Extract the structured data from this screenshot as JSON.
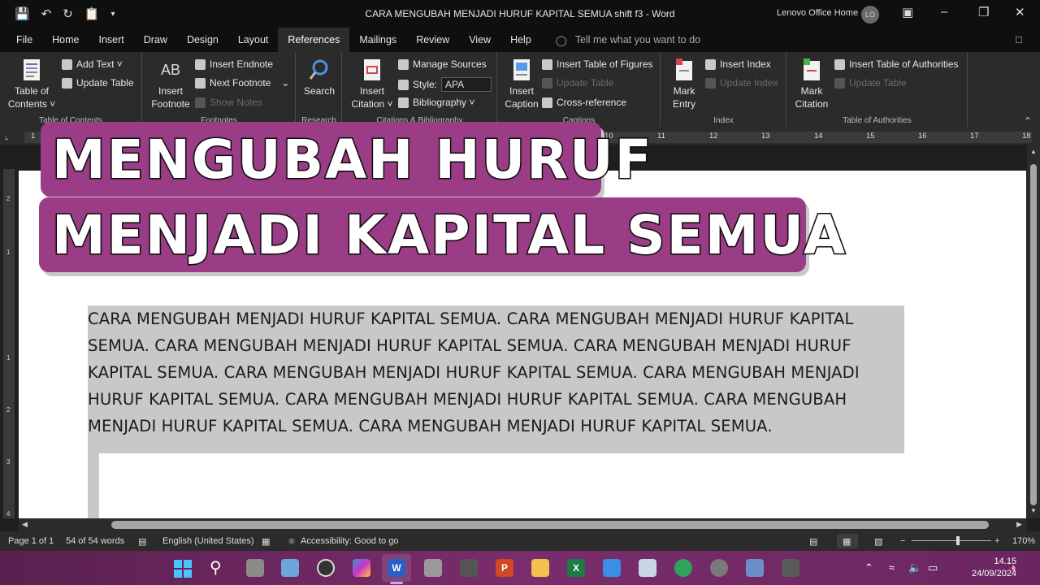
{
  "window": {
    "title": "CARA MENGUBAH MENJADI HURUF KAPITAL SEMUA shift f3  -  Word",
    "account": "Lenovo Office Home",
    "avatar_initials": "LO"
  },
  "tabs": [
    "File",
    "Home",
    "Insert",
    "Draw",
    "Design",
    "Layout",
    "References",
    "Mailings",
    "Review",
    "View",
    "Help"
  ],
  "tell_me": "Tell me what you want to do",
  "ribbon": {
    "toc": {
      "table_of_contents": "Table of Contents ˅",
      "add_text": "Add Text ˅",
      "update_table": "Update Table",
      "label": "Table of Contents"
    },
    "footnotes": {
      "insert_footnote": "Insert Footnote",
      "ab_glyph": "AB",
      "insert_endnote": "Insert Endnote",
      "next_footnote": "Next Footnote",
      "show_notes": "Show Notes",
      "label": "Footnotes"
    },
    "research": {
      "search": "Search",
      "label": "Research"
    },
    "citations": {
      "insert_citation": "Insert Citation ˅",
      "manage_sources": "Manage Sources",
      "style_label": "Style:",
      "style_value": "APA",
      "bibliography": "Bibliography ˅",
      "label": "Citations & Bibliography"
    },
    "captions": {
      "insert_caption": "Insert Caption",
      "insert_table_of_figures": "Insert Table of Figures",
      "update_table": "Update Table",
      "cross_reference": "Cross-reference",
      "label": "Captions"
    },
    "index": {
      "mark_entry": "Mark Entry",
      "insert_index": "Insert Index",
      "update_index": "Update Index",
      "label": "Index"
    },
    "toa": {
      "mark_citation": "Mark Citation",
      "insert_toa": "Insert Table of Authorities",
      "update_table": "Update Table",
      "label": "Table of Authorities"
    }
  },
  "ruler_numbers": [
    "1",
    "10",
    "11",
    "12",
    "13",
    "14",
    "15",
    "16",
    "17",
    "18"
  ],
  "vruler_numbers": [
    "2",
    "1",
    "1",
    "2",
    "3",
    "4"
  ],
  "overlay": {
    "line1": "MENGUBAH  HURUF",
    "line2": "MENJADI  KAPITAL  SEMUA"
  },
  "document": {
    "lines": [
      "CARA MENGUBAH MENJADI HURUF KAPITAL SEMUA. CARA MENGUBAH MENJADI HURUF KAPITAL",
      "SEMUA. CARA MENGUBAH MENJADI HURUF KAPITAL SEMUA. CARA MENGUBAH MENJADI HURUF",
      "KAPITAL SEMUA. CARA MENGUBAH MENJADI HURUF KAPITAL SEMUA. CARA MENGUBAH MENJADI",
      "HURUF KAPITAL SEMUA. CARA MENGUBAH MENJADI HURUF KAPITAL SEMUA. CARA MENGUBAH",
      "MENJADI HURUF KAPITAL SEMUA. CARA MENGUBAH MENJADI HURUF KAPITAL SEMUA."
    ]
  },
  "status": {
    "page": "Page 1 of 1",
    "words": "54 of 54 words",
    "language": "English (United States)",
    "accessibility": "Accessibility: Good to go",
    "zoom_minus": "−",
    "zoom_plus": "+",
    "zoom": "170%"
  },
  "taskbar": {
    "time": "14.15",
    "date": "24/09/2024"
  }
}
